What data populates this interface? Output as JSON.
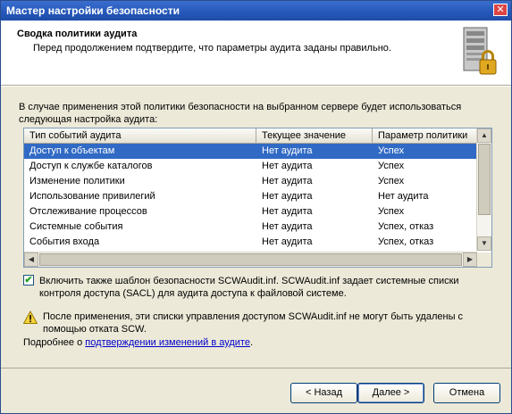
{
  "window": {
    "title": "Мастер настройки безопасности",
    "close_label": "✕"
  },
  "header": {
    "title": "Сводка политики аудита",
    "subtitle": "Перед продолжением подтвердите, что параметры аудита заданы правильно."
  },
  "description": "В случае применения этой политики безопасности на выбранном сервере будет использоваться следующая настройка аудита:",
  "list": {
    "columns": [
      "Тип событий аудита",
      "Текущее значение",
      "Параметр политики"
    ],
    "rows": [
      [
        "Доступ к объектам",
        "Нет аудита",
        "Успех"
      ],
      [
        "Доступ к службе каталогов",
        "Нет аудита",
        "Успех"
      ],
      [
        "Изменение политики",
        "Нет аудита",
        "Успех"
      ],
      [
        "Использование привилегий",
        "Нет аудита",
        "Нет аудита"
      ],
      [
        "Отслеживание процессов",
        "Нет аудита",
        "Успех"
      ],
      [
        "Системные события",
        "Нет аудита",
        "Успех, отказ"
      ],
      [
        "События входа",
        "Нет аудита",
        "Успех, отказ"
      ]
    ],
    "selected_index": 0
  },
  "checkbox": {
    "checked": true,
    "label": "Включить также шаблон безопасности SCWAudit.inf. SCWAudit.inf задает системные списки контроля доступа (SACL) для аудита доступа к файловой системе."
  },
  "warning": {
    "text": "После применения, эти списки управления доступом SCWAudit.inf не могут быть удалены с помощью отката SCW."
  },
  "more": {
    "prefix": "Подробнее о ",
    "link": "подтверждении изменений в аудите",
    "suffix": "."
  },
  "buttons": {
    "back": "< Назад",
    "next": "Далее >",
    "cancel": "Отмена"
  }
}
